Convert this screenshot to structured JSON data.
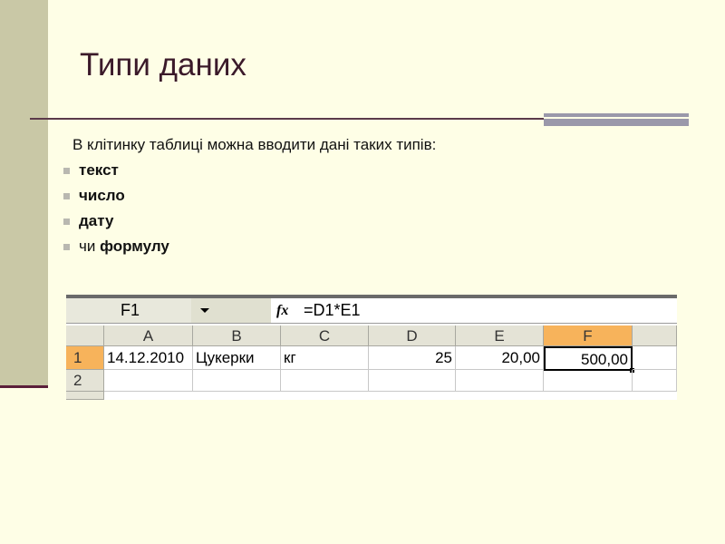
{
  "slide": {
    "title": "Типи даних",
    "intro": "В клітинку таблиці можна вводити дані таких типів:",
    "bullets": [
      {
        "prefix": "",
        "bold": "текст"
      },
      {
        "prefix": "",
        "bold": "число"
      },
      {
        "prefix": "",
        "bold": "дату"
      },
      {
        "prefix": "чи ",
        "bold": "формулу"
      }
    ],
    "colors": {
      "background": "#fefee6",
      "side_bar": "#c9c8a6",
      "accent_line": "#5b1f3a",
      "selected_header": "#f7b35b"
    }
  },
  "spreadsheet": {
    "name_box": "F1",
    "fx_icon": "fx-icon",
    "formula": "=D1*E1",
    "columns": [
      "A",
      "B",
      "C",
      "D",
      "E",
      "F"
    ],
    "rows": [
      {
        "num": "1",
        "cells": [
          "14.12.2010",
          "Цукерки",
          "кг",
          "25",
          "20,00",
          "500,00"
        ]
      },
      {
        "num": "2",
        "cells": [
          "",
          "",
          "",
          "",
          "",
          ""
        ]
      }
    ],
    "selected_cell": "F1"
  }
}
